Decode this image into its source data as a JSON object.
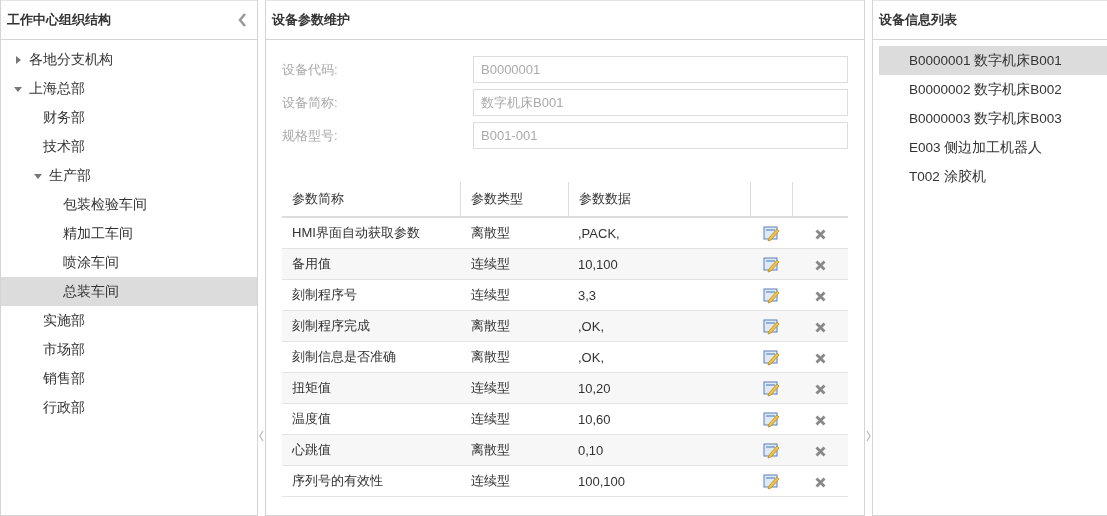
{
  "org_panel": {
    "title": "工作中心组织结构",
    "tree": [
      {
        "label": "各地分支机构",
        "expanded": false,
        "selected": false
      },
      {
        "label": "上海总部",
        "expanded": true,
        "selected": false,
        "children": [
          {
            "label": "财务部",
            "selected": false
          },
          {
            "label": "技术部",
            "selected": false
          },
          {
            "label": "生产部",
            "expanded": true,
            "selected": false,
            "children": [
              {
                "label": "包装检验车间",
                "selected": false
              },
              {
                "label": "精加工车间",
                "selected": false
              },
              {
                "label": "喷涂车间",
                "selected": false
              },
              {
                "label": "总装车间",
                "selected": true
              }
            ]
          },
          {
            "label": "实施部",
            "selected": false
          },
          {
            "label": "市场部",
            "selected": false
          },
          {
            "label": "销售部",
            "selected": false
          },
          {
            "label": "行政部",
            "selected": false
          }
        ]
      }
    ]
  },
  "param_panel": {
    "title": "设备参数维护",
    "fields": [
      {
        "label": "设备代码:",
        "value": "B0000001",
        "disabled": true
      },
      {
        "label": "设备简称:",
        "value": "数字机床B001",
        "disabled": true
      },
      {
        "label": "规格型号:",
        "value": "B001-001",
        "disabled": true
      }
    ],
    "table": {
      "columns": [
        "参数简称",
        "参数类型",
        "参数数据"
      ],
      "rows": [
        [
          "HMI界面自动获取参数",
          "离散型",
          ",PACK,"
        ],
        [
          "备用值",
          "连续型",
          "10,100"
        ],
        [
          "刻制程序号",
          "连续型",
          "3,3"
        ],
        [
          "刻制程序完成",
          "离散型",
          ",OK,"
        ],
        [
          "刻制信息是否准确",
          "离散型",
          ",OK,"
        ],
        [
          "扭矩值",
          "连续型",
          "10,20"
        ],
        [
          "温度值",
          "连续型",
          "10,60"
        ],
        [
          "心跳值",
          "离散型",
          "0,10"
        ],
        [
          "序列号的有效性",
          "连续型",
          "100,100"
        ]
      ]
    }
  },
  "device_panel": {
    "title": "设备信息列表",
    "items": [
      {
        "label": "B0000001 数字机床B001",
        "selected": true
      },
      {
        "label": "B0000002 数字机床B002",
        "selected": false
      },
      {
        "label": "B0000003 数字机床B003",
        "selected": false
      },
      {
        "label": "E003 侧边加工机器人",
        "selected": false
      },
      {
        "label": "T002 涂胶机",
        "selected": false
      }
    ]
  }
}
